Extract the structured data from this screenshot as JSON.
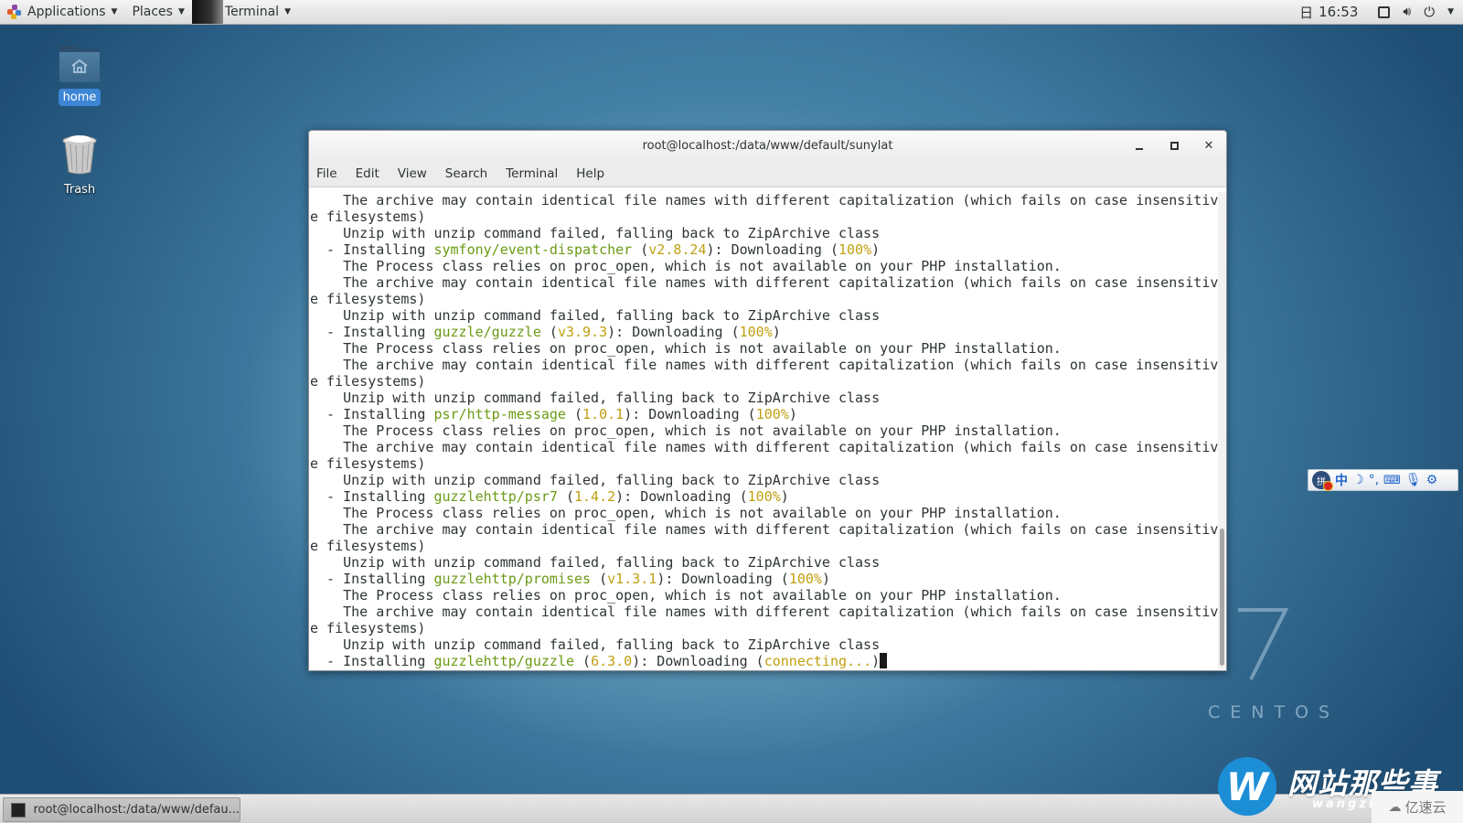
{
  "topbar": {
    "applications_label": "Applications",
    "places_label": "Places",
    "terminal_label": "Terminal",
    "calendar_glyph": "日",
    "clock": "16:53"
  },
  "desktop": {
    "icons": [
      {
        "label": "home",
        "icon": "home-folder-icon"
      },
      {
        "label": "Trash",
        "icon": "trash-icon"
      }
    ]
  },
  "window": {
    "title": "root@localhost:/data/www/default/sunylat",
    "menu": [
      "File",
      "Edit",
      "View",
      "Search",
      "Terminal",
      "Help"
    ],
    "controls": {
      "minimize": "_",
      "maximize": "□",
      "close": "✕"
    }
  },
  "terminal": {
    "lines": [
      [
        {
          "t": "    The archive may contain identical file names with different capitalization (which fails on case insensitiv"
        }
      ],
      [
        {
          "t": "e filesystems)"
        }
      ],
      [
        {
          "t": "    Unzip with unzip command failed, falling back to ZipArchive class"
        }
      ],
      [
        {
          "t": "  - Installing "
        },
        {
          "t": "symfony/event-dispatcher",
          "c": "green"
        },
        {
          "t": " ("
        },
        {
          "t": "v2.8.24",
          "c": "yellow"
        },
        {
          "t": "): Downloading ("
        },
        {
          "t": "100%",
          "c": "yellow"
        },
        {
          "t": ")"
        }
      ],
      [
        {
          "t": "    The Process class relies on proc_open, which is not available on your PHP installation."
        }
      ],
      [
        {
          "t": "    The archive may contain identical file names with different capitalization (which fails on case insensitiv"
        }
      ],
      [
        {
          "t": "e filesystems)"
        }
      ],
      [
        {
          "t": "    Unzip with unzip command failed, falling back to ZipArchive class"
        }
      ],
      [
        {
          "t": "  - Installing "
        },
        {
          "t": "guzzle/guzzle",
          "c": "green"
        },
        {
          "t": " ("
        },
        {
          "t": "v3.9.3",
          "c": "yellow"
        },
        {
          "t": "): Downloading ("
        },
        {
          "t": "100%",
          "c": "yellow"
        },
        {
          "t": ")"
        }
      ],
      [
        {
          "t": "    The Process class relies on proc_open, which is not available on your PHP installation."
        }
      ],
      [
        {
          "t": "    The archive may contain identical file names with different capitalization (which fails on case insensitiv"
        }
      ],
      [
        {
          "t": "e filesystems)"
        }
      ],
      [
        {
          "t": "    Unzip with unzip command failed, falling back to ZipArchive class"
        }
      ],
      [
        {
          "t": "  - Installing "
        },
        {
          "t": "psr/http-message",
          "c": "green"
        },
        {
          "t": " ("
        },
        {
          "t": "1.0.1",
          "c": "yellow"
        },
        {
          "t": "): Downloading ("
        },
        {
          "t": "100%",
          "c": "yellow"
        },
        {
          "t": ")"
        }
      ],
      [
        {
          "t": "    The Process class relies on proc_open, which is not available on your PHP installation."
        }
      ],
      [
        {
          "t": "    The archive may contain identical file names with different capitalization (which fails on case insensitiv"
        }
      ],
      [
        {
          "t": "e filesystems)"
        }
      ],
      [
        {
          "t": "    Unzip with unzip command failed, falling back to ZipArchive class"
        }
      ],
      [
        {
          "t": "  - Installing "
        },
        {
          "t": "guzzlehttp/psr7",
          "c": "green"
        },
        {
          "t": " ("
        },
        {
          "t": "1.4.2",
          "c": "yellow"
        },
        {
          "t": "): Downloading ("
        },
        {
          "t": "100%",
          "c": "yellow"
        },
        {
          "t": ")"
        }
      ],
      [
        {
          "t": "    The Process class relies on proc_open, which is not available on your PHP installation."
        }
      ],
      [
        {
          "t": "    The archive may contain identical file names with different capitalization (which fails on case insensitiv"
        }
      ],
      [
        {
          "t": "e filesystems)"
        }
      ],
      [
        {
          "t": "    Unzip with unzip command failed, falling back to ZipArchive class"
        }
      ],
      [
        {
          "t": "  - Installing "
        },
        {
          "t": "guzzlehttp/promises",
          "c": "green"
        },
        {
          "t": " ("
        },
        {
          "t": "v1.3.1",
          "c": "yellow"
        },
        {
          "t": "): Downloading ("
        },
        {
          "t": "100%",
          "c": "yellow"
        },
        {
          "t": ")"
        }
      ],
      [
        {
          "t": "    The Process class relies on proc_open, which is not available on your PHP installation."
        }
      ],
      [
        {
          "t": "    The archive may contain identical file names with different capitalization (which fails on case insensitiv"
        }
      ],
      [
        {
          "t": "e filesystems)"
        }
      ],
      [
        {
          "t": "    Unzip with unzip command failed, falling back to ZipArchive class"
        }
      ],
      [
        {
          "t": "  - Installing "
        },
        {
          "t": "guzzlehttp/guzzle",
          "c": "green"
        },
        {
          "t": " ("
        },
        {
          "t": "6.3.0",
          "c": "yellow"
        },
        {
          "t": "): Downloading ("
        },
        {
          "t": "connecting...",
          "c": "yellow"
        },
        {
          "t": ")"
        },
        {
          "cursor": true
        }
      ]
    ]
  },
  "ime_toolbar": {
    "logo_glyph": "拼",
    "mode_glyph": "中",
    "items": [
      "chinese-mode-icon",
      "halfwidth-moon-icon",
      "punctuation-icon",
      "keyboard-icon",
      "microphone-icon",
      "settings-gear-icon"
    ]
  },
  "watermark": {
    "os_version": "7",
    "os_name": "CENTOS",
    "site_logo_letter": "W",
    "site_name": "网站那些事",
    "site_sub": "wangzh",
    "partner": "亿速云"
  },
  "taskbar": {
    "items": [
      {
        "label": "root@localhost:/data/www/defau..."
      }
    ]
  },
  "colors": {
    "package_green": "#6a9a14",
    "version_yellow": "#bfa010",
    "home_label_bg": "#3d86d6"
  }
}
